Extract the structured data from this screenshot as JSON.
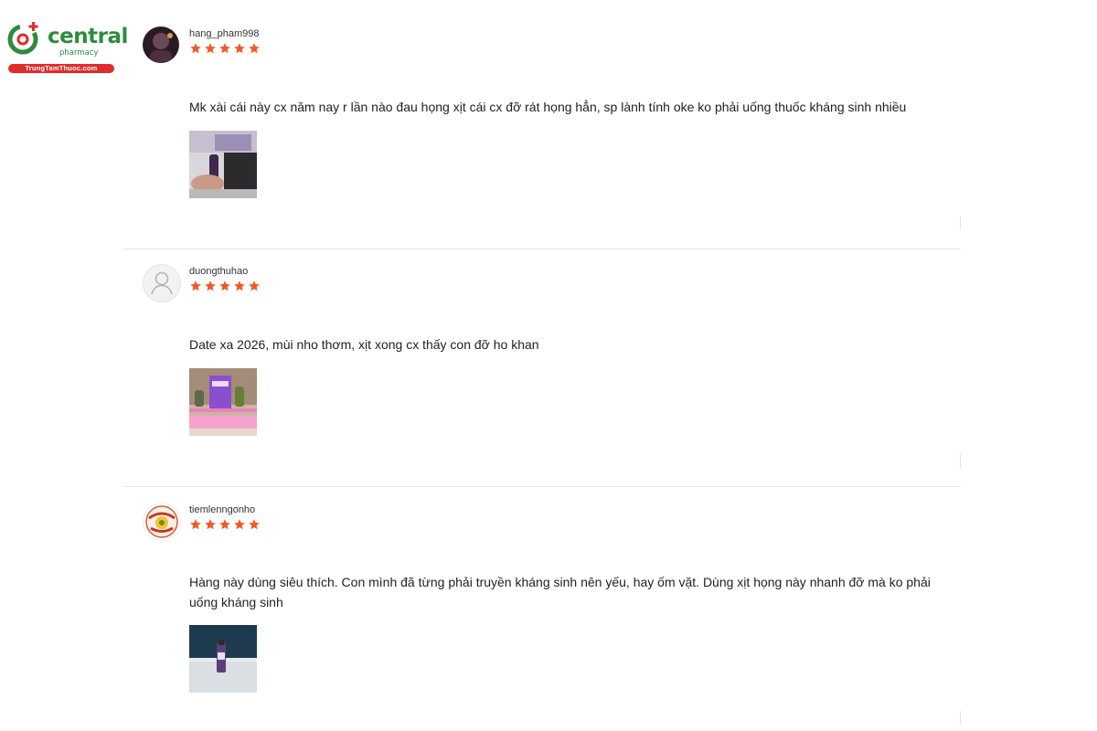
{
  "logo": {
    "word": "central",
    "sub": "pharmacy",
    "site": "TrungTamThuoc.com",
    "colors": {
      "brand_green": "#2e8b3d",
      "brand_red": "#e02c2c"
    }
  },
  "rating_color": "#f05a28",
  "reviews": [
    {
      "username": "hang_pham998",
      "rating": 5,
      "avatar_icon": "user-photo-avatar",
      "comment": "Mk xài cái này cx năm nay r lần nào đau họng xịt cái cx đỡ rát họng hẳn, sp lành tính oke ko phải uống thuốc kháng sinh nhiều"
    },
    {
      "username": "duongthuhao",
      "rating": 5,
      "avatar_icon": "default-user-icon",
      "comment": "Date xa 2026, mùi nho thơm, xịt xong cx thấy con đỡ ho khan"
    },
    {
      "username": "tiemlenngonho",
      "rating": 5,
      "avatar_icon": "shop-badge-avatar",
      "comment": "Hàng này dùng siêu thích. Con mình đã từng phải truyền kháng sinh nên yếu, hay ốm vặt. Dùng xịt họng này nhanh đỡ mà ko phải uống kháng sinh"
    }
  ]
}
